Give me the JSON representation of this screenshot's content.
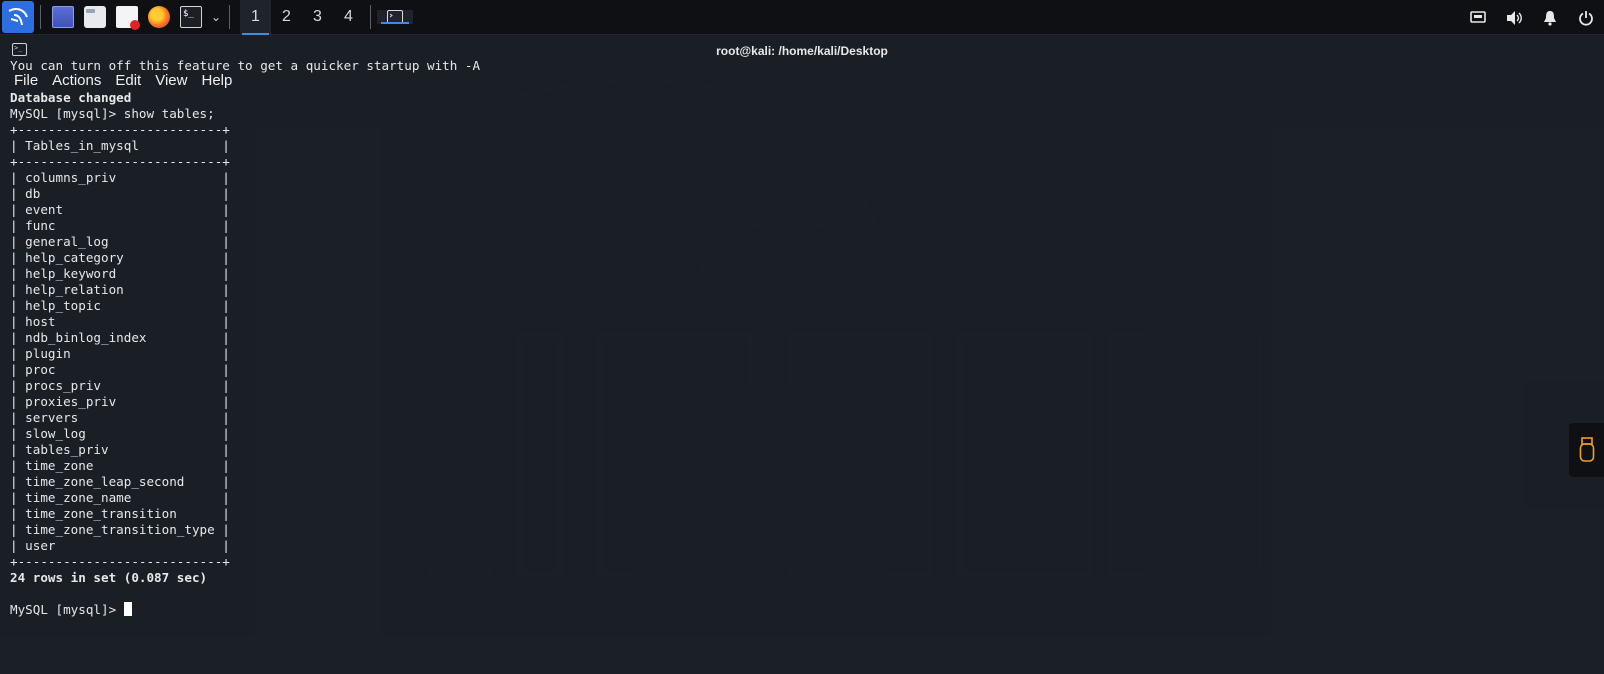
{
  "panel": {
    "workspaces": [
      "1",
      "2",
      "3",
      "4"
    ],
    "active_workspace": "1",
    "launcher_icons": [
      "kali-menu-icon",
      "terminal-emulator-icon",
      "file-manager-icon",
      "text-editor-icon",
      "firefox-icon",
      "terminal-icon"
    ],
    "tray_icons": [
      "network-icon",
      "volume-icon",
      "notifications-icon",
      "power-icon"
    ]
  },
  "window": {
    "title": "root@kali: /home/kali/Desktop",
    "menu": [
      "File",
      "Actions",
      "Edit",
      "View",
      "Help"
    ]
  },
  "terminal": {
    "lines": [
      {
        "text": "You can turn off this feature to get a quicker startup with -A",
        "bold": false
      },
      {
        "text": "",
        "bold": false
      },
      {
        "text": "Database changed",
        "bold": true
      },
      {
        "text": "MySQL [mysql]> show tables;",
        "bold": false
      },
      {
        "text": "+---------------------------+",
        "bold": false
      },
      {
        "text": "| Tables_in_mysql           |",
        "bold": false
      },
      {
        "text": "+---------------------------+",
        "bold": false
      },
      {
        "text": "| columns_priv              |",
        "bold": false
      },
      {
        "text": "| db                        |",
        "bold": false
      },
      {
        "text": "| event                     |",
        "bold": false
      },
      {
        "text": "| func                      |",
        "bold": false
      },
      {
        "text": "| general_log               |",
        "bold": false
      },
      {
        "text": "| help_category             |",
        "bold": false
      },
      {
        "text": "| help_keyword              |",
        "bold": false
      },
      {
        "text": "| help_relation             |",
        "bold": false
      },
      {
        "text": "| help_topic                |",
        "bold": false
      },
      {
        "text": "| host                      |",
        "bold": false
      },
      {
        "text": "| ndb_binlog_index          |",
        "bold": false
      },
      {
        "text": "| plugin                    |",
        "bold": false
      },
      {
        "text": "| proc                      |",
        "bold": false
      },
      {
        "text": "| procs_priv                |",
        "bold": false
      },
      {
        "text": "| proxies_priv              |",
        "bold": false
      },
      {
        "text": "| servers                   |",
        "bold": false
      },
      {
        "text": "| slow_log                  |",
        "bold": false
      },
      {
        "text": "| tables_priv               |",
        "bold": false
      },
      {
        "text": "| time_zone                 |",
        "bold": false
      },
      {
        "text": "| time_zone_leap_second     |",
        "bold": false
      },
      {
        "text": "| time_zone_name            |",
        "bold": false
      },
      {
        "text": "| time_zone_transition      |",
        "bold": false
      },
      {
        "text": "| time_zone_transition_type |",
        "bold": false
      },
      {
        "text": "| user                      |",
        "bold": false
      },
      {
        "text": "+---------------------------+",
        "bold": false
      },
      {
        "text": "24 rows in set (0.087 sec)",
        "bold": true
      },
      {
        "text": "",
        "bold": false
      },
      {
        "text": "MySQL [mysql]> ",
        "bold": false
      }
    ],
    "prompt_line_index": 34
  },
  "colors": {
    "panel_bg": "#0e1014",
    "terminal_bg": "#1b1f27",
    "accent": "#3a8ee6",
    "kali_blue": "#2d6ee0"
  }
}
